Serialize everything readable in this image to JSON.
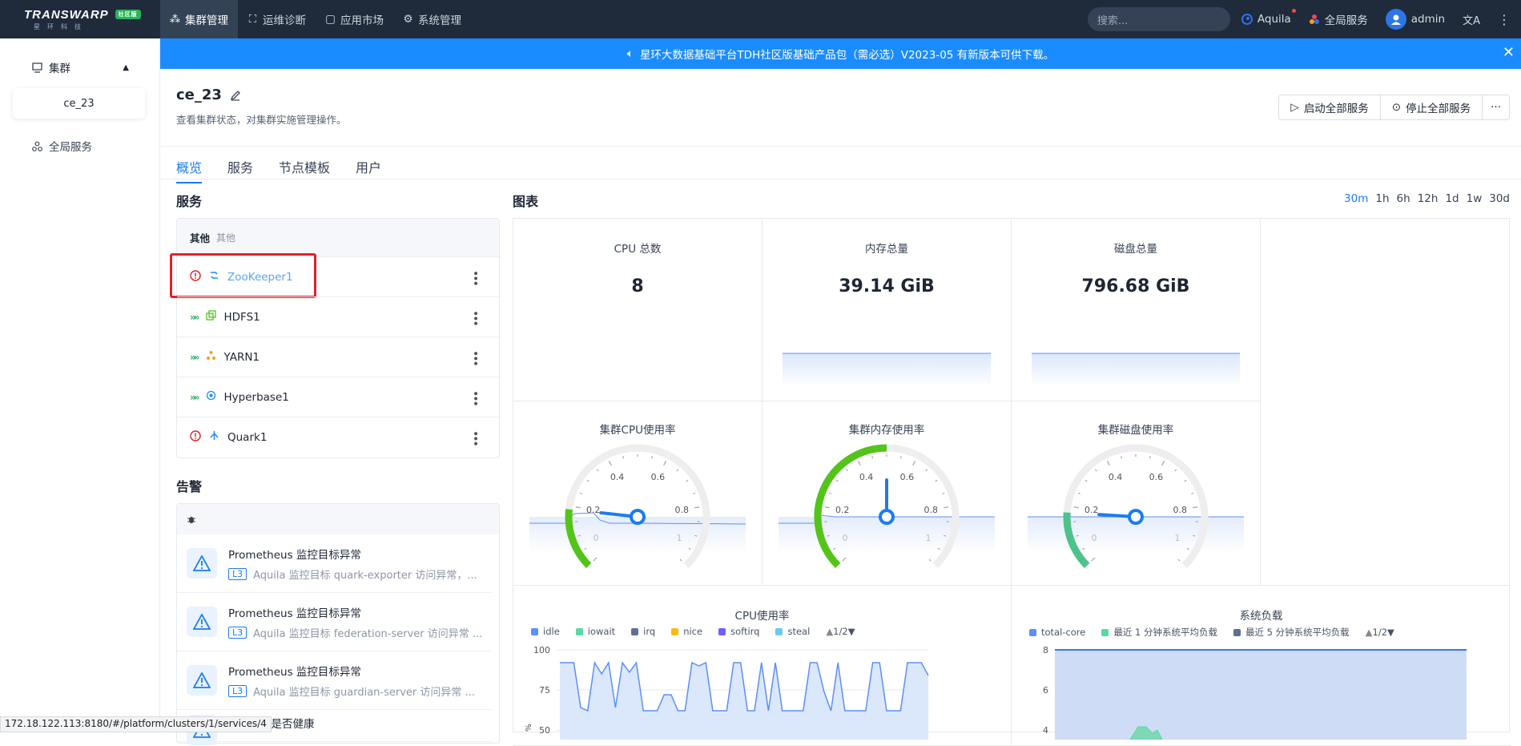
{
  "topbar": {
    "logo_text": "TRANSWARP",
    "logo_badge": "社区版",
    "logo_sub": "星环科技",
    "nav": [
      {
        "label": "集群管理",
        "icon": "cluster-icon",
        "active": true
      },
      {
        "label": "运维诊断",
        "icon": "diagnose-icon",
        "active": false
      },
      {
        "label": "应用市场",
        "icon": "market-icon",
        "active": false
      },
      {
        "label": "系统管理",
        "icon": "gear-icon",
        "active": false
      }
    ],
    "search_placeholder": "搜索...",
    "aquila": "Aquila",
    "global_services": "全局服务",
    "user": "admin"
  },
  "sidebar": {
    "group_label": "集群",
    "selected_cluster": "ce_23",
    "global_services": "全局服务"
  },
  "banner": {
    "text": "星环大数据基础平台TDH社区版基础产品包（需必选）V2023-05 有新版本可供下载。"
  },
  "header": {
    "title": "ce_23",
    "description": "查看集群状态，对集群实施管理操作。",
    "start_all": "启动全部服务",
    "stop_all": "停止全部服务"
  },
  "tabs": [
    "概览",
    "服务",
    "节点模板",
    "用户"
  ],
  "services": {
    "title": "服务",
    "group_label": "其他",
    "group_sub": "其他",
    "items": [
      {
        "name": "ZooKeeper1",
        "status": "error"
      },
      {
        "name": "HDFS1",
        "status": "running"
      },
      {
        "name": "YARN1",
        "status": "running"
      },
      {
        "name": "Hyperbase1",
        "status": "running"
      },
      {
        "name": "Quark1",
        "status": "error"
      }
    ]
  },
  "alerts": {
    "title": "告警",
    "items": [
      {
        "title": "Prometheus 监控目标异常",
        "level": "L3",
        "desc": "Aquila 监控目标 quark-exporter 访问异常，..."
      },
      {
        "title": "Prometheus 监控目标异常",
        "level": "L3",
        "desc": "Aquila 监控目标 federation-server 访问异常 ..."
      },
      {
        "title": "Prometheus 监控目标异常",
        "level": "L3",
        "desc": "Aquila 监控目标 guardian-server 访问异常 ..."
      },
      {
        "title": "NTP服务是否健康",
        "level": "",
        "desc": ""
      }
    ]
  },
  "charts": {
    "title": "图表",
    "time_ranges": [
      "30m",
      "1h",
      "6h",
      "12h",
      "1d",
      "1w",
      "30d"
    ],
    "selected_range": "30m",
    "stats": [
      {
        "label": "CPU 总数",
        "value": "8"
      },
      {
        "label": "内存总量",
        "value": "39.14 GiB"
      },
      {
        "label": "磁盘总量",
        "value": "796.68 GiB"
      }
    ],
    "gauges": [
      {
        "label": "集群CPU使用率",
        "value": 0.19,
        "color": "#52c41a"
      },
      {
        "label": "集群内存使用率",
        "value": 0.5,
        "color": "#52c41a"
      },
      {
        "label": "集群磁盘使用率",
        "value": 0.18,
        "color": "#4cc38a"
      }
    ],
    "gauge_ticks": [
      "0",
      "0.2",
      "0.4",
      "0.6",
      "0.8",
      "1"
    ],
    "cpu_chart": {
      "title": "CPU使用率",
      "legend": [
        {
          "name": "idle",
          "color": "#5b8ff9"
        },
        {
          "name": "iowait",
          "color": "#5ad8a6"
        },
        {
          "name": "irq",
          "color": "#5d7092"
        },
        {
          "name": "nice",
          "color": "#f6bd16"
        },
        {
          "name": "softirq",
          "color": "#6f5ef9"
        },
        {
          "name": "steal",
          "color": "#6dc8ec"
        }
      ],
      "pager": "1/2",
      "y_ticks": [
        "100",
        "75",
        "50"
      ],
      "y_unit": "%"
    },
    "load_chart": {
      "title": "系统负载",
      "legend": [
        {
          "name": "total-core",
          "color": "#5b8ff9"
        },
        {
          "name": "最近 1 分钟系统平均负载",
          "color": "#5ad8a6"
        },
        {
          "name": "最近 5 分钟系统平均负载",
          "color": "#5d7092"
        }
      ],
      "pager": "1/2",
      "y_ticks": [
        "8",
        "6",
        "4"
      ]
    }
  },
  "statusbar": {
    "url": "172.18.122.113:8180/#/platform/clusters/1/services/4"
  }
}
